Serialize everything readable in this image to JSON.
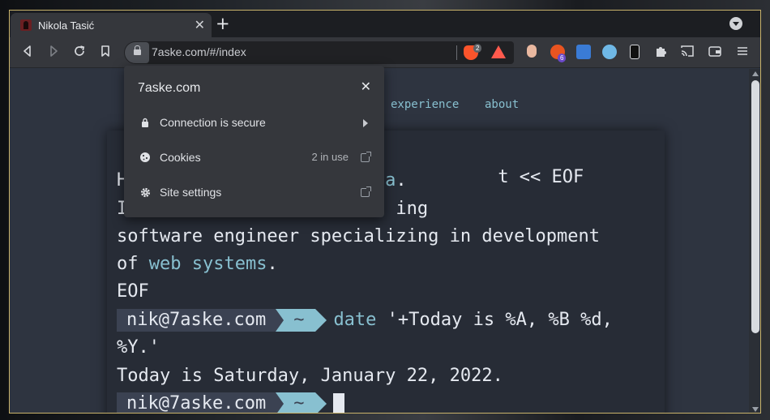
{
  "browser": {
    "tab": {
      "title": "Nikola Tasić",
      "close": "✕"
    },
    "new_tab": "+",
    "url": "7aske.com/#/index",
    "shields_badge": "2",
    "ext_badge": "6"
  },
  "nav": {
    "items": [
      {
        "label": "experience"
      },
      {
        "label": "about"
      }
    ]
  },
  "terminal": {
    "line1_tail": "t << EOF",
    "line2_start": "H",
    "line2_hl": "a",
    "line2_end": ".",
    "line3_start": "I",
    "line3_end": "ing",
    "line4": "software engineer specializing in development",
    "line5_start": "of ",
    "line5_hl": "web systems",
    "line5_end": ".",
    "line6": "EOF",
    "prompt_host": "nik@7aske.com",
    "prompt_dir": "~",
    "cmd1_name": "date",
    "cmd1_args": " '+Today is %A, %B %d,",
    "cmd1_cont": "%Y.'",
    "output": "Today is Saturday, January 22, 2022."
  },
  "popup": {
    "title": "7aske.com",
    "close": "✕",
    "rows": [
      {
        "label": "Connection is secure",
        "icon": "lock-icon"
      },
      {
        "label": "Cookies",
        "right": "2 in use",
        "icon": "cookie-icon"
      },
      {
        "label": "Site settings",
        "icon": "gear-icon"
      }
    ]
  },
  "colors": {
    "accent": "#88c0d0",
    "terminal_bg": "#272c36",
    "page_bg": "#2e3440",
    "window_border": "#c9b36b"
  }
}
